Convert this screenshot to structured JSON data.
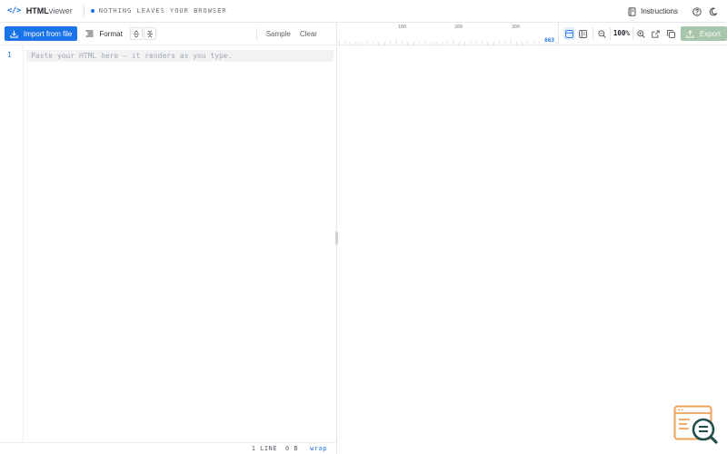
{
  "app": {
    "logo_code": "</>",
    "logo_strong": "HTML",
    "logo_light": "viewer",
    "tagline": "NOTHING LEAVES YOUR BROWSER"
  },
  "header": {
    "instructions_label": "Instructions",
    "icons": [
      "book-icon",
      "help-icon",
      "moon-icon"
    ]
  },
  "toolbar": {
    "import_label": "Import from file",
    "format_label": "Format",
    "sample_label": "Sample",
    "clear_label": "Clear"
  },
  "editor": {
    "line_number": "1",
    "placeholder": "Paste your HTML here — it renders as you type."
  },
  "status": {
    "lines": "1 LINE",
    "size": "0 B",
    "wrap": "wrap"
  },
  "ruler": {
    "tick_labels": [
      "100",
      "200",
      "300"
    ],
    "width_value": "663"
  },
  "view": {
    "zoom": "100%",
    "export_label": "Export"
  },
  "colors": {
    "accent": "#1a73e8",
    "export_disabled": "#a9c6ad",
    "badge_orange": "#f0a25a",
    "badge_teal": "#1f4f4a"
  }
}
